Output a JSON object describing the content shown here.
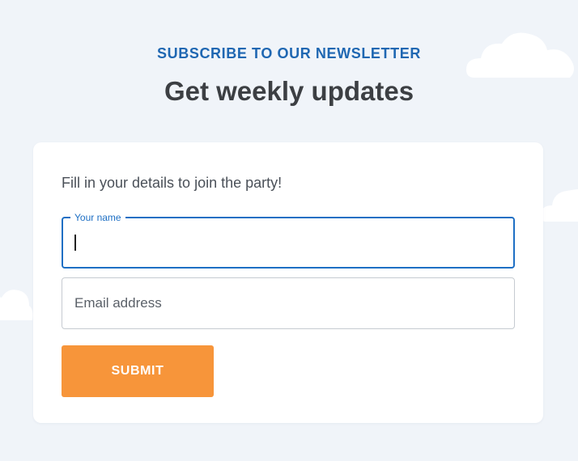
{
  "colors": {
    "background": "#f0f4f9",
    "eyebrow": "#1f67b2",
    "headline": "#3c3f43",
    "focus_accent": "#1e6fc4",
    "submit_bg": "#f7953a",
    "cloud": "#ffffff"
  },
  "header": {
    "eyebrow": "SUBSCRIBE TO OUR NEWSLETTER",
    "title": "Get weekly updates"
  },
  "form": {
    "intro": "Fill in your details to join the party!",
    "name_field": {
      "label": "Your name",
      "value": ""
    },
    "email_field": {
      "placeholder": "Email address",
      "value": ""
    },
    "submit_label": "SUBMIT"
  }
}
